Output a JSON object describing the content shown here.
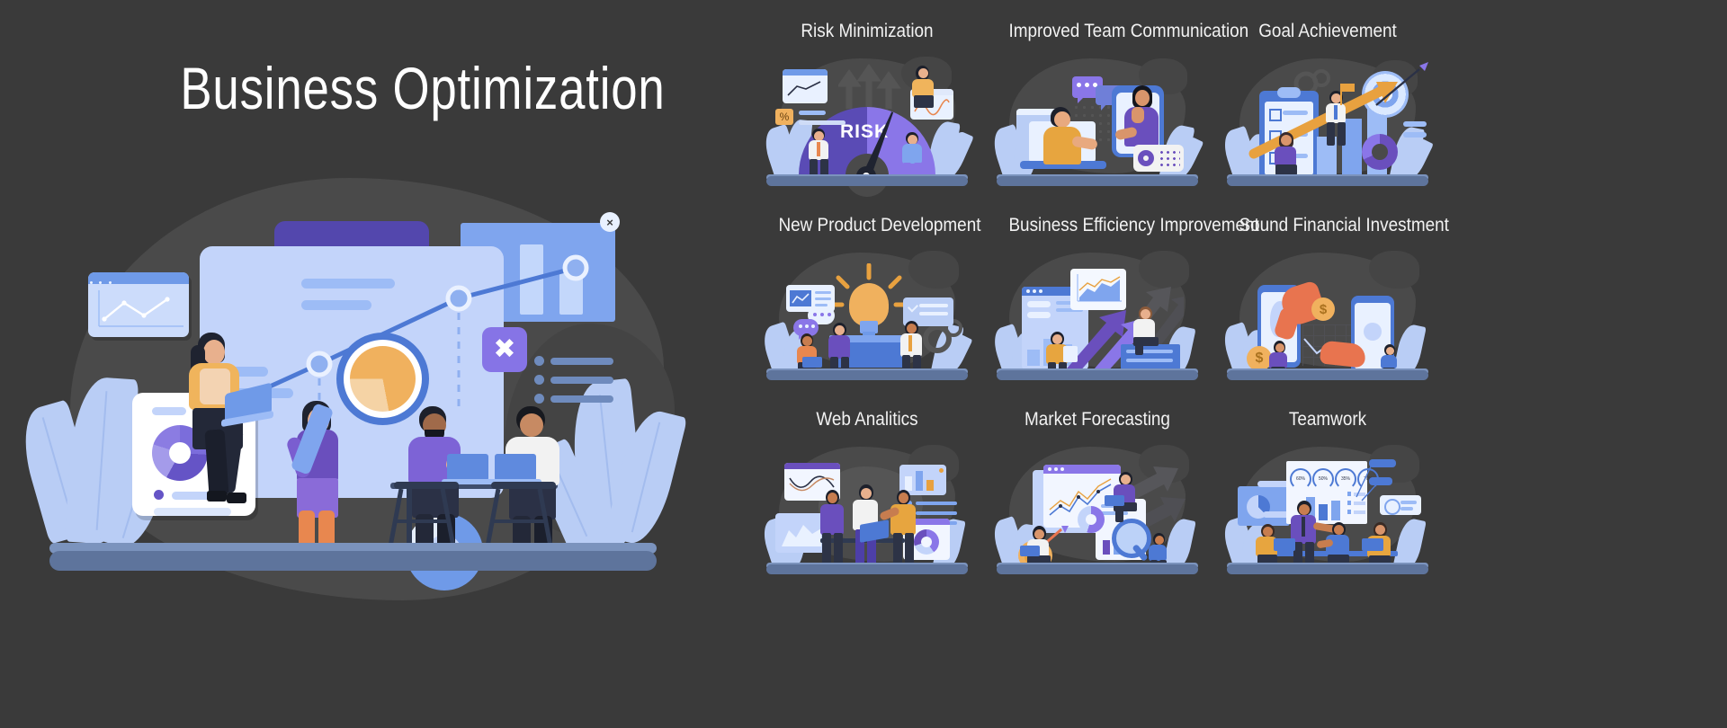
{
  "page": {
    "background_color": "#3a3a3a",
    "hero_title": "Business Optimization"
  },
  "palette": {
    "background": "#3a3a3a",
    "blob": "#4a4a4a",
    "light_blue": "#c3d4fa",
    "blue": "#6f9ae8",
    "deep_blue": "#4d79d4",
    "purple": "#5347ad",
    "light_purple": "#8674e6",
    "orange": "#f0b15e",
    "leaf": "#b9cdf5",
    "ground": "#5e749c",
    "white": "#ffffff",
    "text": "#f2f2f2"
  },
  "hero": {
    "title": "Business Optimization",
    "close_badge_label": "×",
    "x_button_label": "✖",
    "chart_card": {
      "name": "line-chart-window",
      "dots": 3
    },
    "report_card": {
      "name": "donut-report-card"
    },
    "magnifier": {
      "name": "magnifier-pie-chart"
    }
  },
  "grid": {
    "columns": 3,
    "rows": 3,
    "cells": [
      {
        "id": "risk-minimization",
        "label": "Risk Minimization",
        "scene": "gauge",
        "gauge_label": "RISK",
        "percent_badge": "%"
      },
      {
        "id": "improved-team-communication",
        "label": "Improved Team Communication",
        "scene": "handshake"
      },
      {
        "id": "goal-achievement",
        "label": "Goal Achievement",
        "scene": "target-arrow"
      },
      {
        "id": "new-product-development",
        "label": "New Product Development",
        "scene": "lightbulb"
      },
      {
        "id": "business-efficiency-improvement",
        "label": "Business Efficiency Improvement",
        "scene": "dashboard-arrows"
      },
      {
        "id": "sound-financial-investment",
        "label": "Sound Financial Investment",
        "scene": "coin-hands",
        "coin_symbol": "$"
      },
      {
        "id": "web-analitics",
        "label": "Web Analitics",
        "scene": "analytics-team"
      },
      {
        "id": "market-forecasting",
        "label": "Market Forecasting",
        "scene": "monitor-magnifier"
      },
      {
        "id": "teamwork",
        "label": "Teamwork",
        "scene": "presentation",
        "gauges": [
          "60%",
          "50%",
          "35%",
          "70%"
        ]
      }
    ]
  }
}
